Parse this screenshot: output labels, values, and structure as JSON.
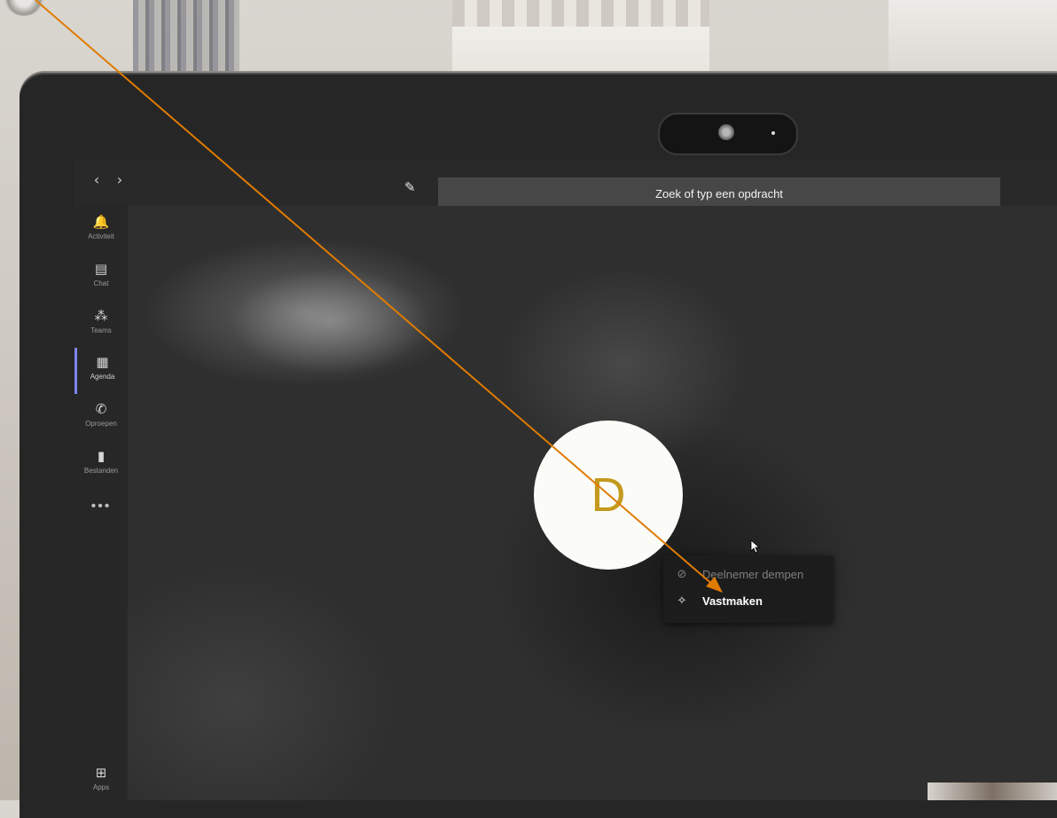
{
  "titlebar": {
    "back_icon": "chevron-left-icon",
    "forward_icon": "chevron-right-icon",
    "compose_icon": "compose-icon",
    "search_placeholder": "Zoek of typ een opdracht"
  },
  "sidebar": {
    "items": [
      {
        "label": "Activiteit",
        "icon": "bell-icon"
      },
      {
        "label": "Chat",
        "icon": "chat-icon"
      },
      {
        "label": "Teams",
        "icon": "teams-icon"
      },
      {
        "label": "Agenda",
        "icon": "calendar-icon",
        "active": true
      },
      {
        "label": "Oproepen",
        "icon": "phone-icon"
      },
      {
        "label": "Bestanden",
        "icon": "file-icon"
      }
    ],
    "more": "•••",
    "apps_label": "Apps"
  },
  "call": {
    "avatar_initial": "D"
  },
  "context_menu": {
    "items": [
      {
        "label": "Deelnemer dempen",
        "icon": "mic-off-icon",
        "enabled": false
      },
      {
        "label": "Vastmaken",
        "icon": "pin-icon",
        "enabled": true
      }
    ]
  },
  "colors": {
    "avatar_initial": "#c49a1c",
    "annotation_arrow": "#e07b00",
    "active_indicator": "#7f85f5"
  }
}
